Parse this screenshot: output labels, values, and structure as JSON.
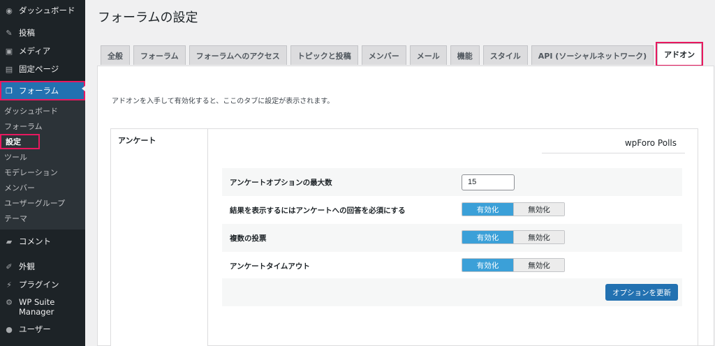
{
  "sidebar": {
    "top_items": [
      {
        "label": "ダッシュボード",
        "icon": "dashboard-icon"
      },
      {
        "label": "投稿",
        "icon": "pin-icon"
      },
      {
        "label": "メディア",
        "icon": "media-icon"
      },
      {
        "label": "固定ページ",
        "icon": "page-icon"
      }
    ],
    "forum": {
      "label": "フォーラム",
      "icon": "forum-icon"
    },
    "submenu": [
      "ダッシュボード",
      "フォーラム",
      "設定",
      "ツール",
      "モデレーション",
      "メンバー",
      "ユーザーグループ",
      "テーマ"
    ],
    "bottom_items": [
      {
        "label": "コメント",
        "icon": "comment-icon"
      },
      {
        "label": "外観",
        "icon": "brush-icon"
      },
      {
        "label": "プラグイン",
        "icon": "plugin-icon"
      },
      {
        "label_line1": "WP Suite",
        "label_line2": "Manager",
        "icon": "gear-icon"
      },
      {
        "label": "ユーザー",
        "icon": "user-icon"
      }
    ]
  },
  "page": {
    "title": "フォーラムの設定"
  },
  "tabs": [
    "全般",
    "フォーラム",
    "フォーラムへのアクセス",
    "トピックと投稿",
    "メンバー",
    "メール",
    "機能",
    "スタイル",
    "API (ソーシャルネットワーク)",
    "アドオン"
  ],
  "active_tab": "アドオン",
  "description": "アドオンを入手して有効化すると、ここのタブに設定が表示されます。",
  "addon_section": {
    "side_label": "アンケート",
    "title": "wpForo Polls",
    "rows": [
      {
        "label": "アンケートオプションの最大数",
        "value": "15"
      },
      {
        "label": "結果を表示するにはアンケートへの回答を必須にする",
        "on": "有効化",
        "off": "無効化"
      },
      {
        "label": "複数の投票",
        "on": "有効化",
        "off": "無効化"
      },
      {
        "label": "アンケートタイムアウト",
        "on": "有効化",
        "off": "無効化"
      }
    ],
    "save_label": "オプションを更新"
  },
  "colors": {
    "accent": "#2271b1",
    "highlight": "#e8185f",
    "toggle_on": "#3ba0d8",
    "sidebar_bg": "#1d2327"
  }
}
